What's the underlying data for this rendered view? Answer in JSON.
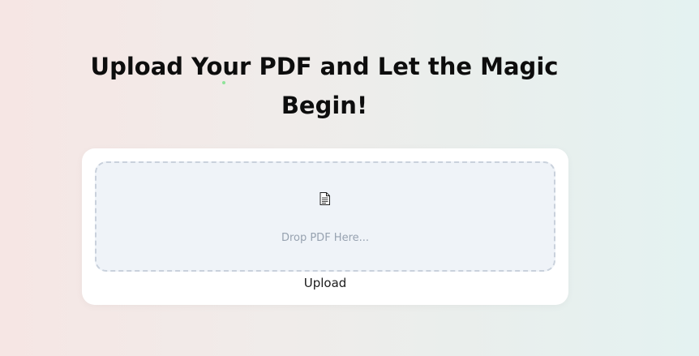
{
  "header": {
    "title": "Upload Your PDF and Let the Magic Begin!"
  },
  "dropzone": {
    "icon": "document-icon",
    "placeholder": "Drop PDF Here..."
  },
  "actions": {
    "upload_label": "Upload"
  },
  "colors": {
    "dropzone_background": "#eff3f8",
    "dropzone_border": "#c9d1dc",
    "card_background": "#ffffff"
  }
}
